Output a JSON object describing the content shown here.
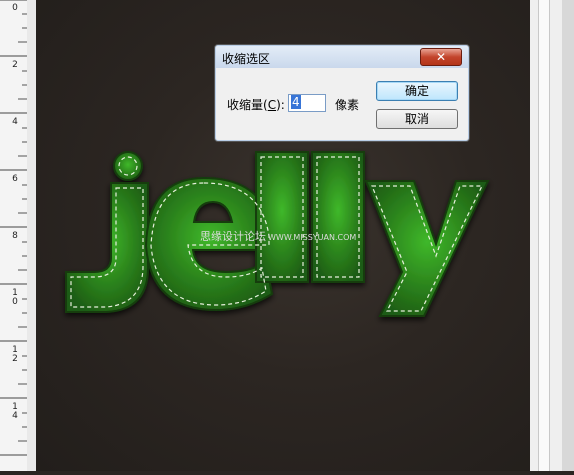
{
  "ruler": {
    "labels": [
      "0",
      "2",
      "4",
      "6",
      "8",
      "10",
      "12",
      "14"
    ]
  },
  "artwork": {
    "text": "jelly",
    "fill_color": "#2e8b1e",
    "stitch_color": "#e6f0dc"
  },
  "watermark": {
    "cn": "思缘设计论坛",
    "en": "WWW.MISSYUAN.COM"
  },
  "dialog": {
    "title": "收缩选区",
    "close": "✕",
    "field_label_prefix": "收缩量(",
    "field_label_key": "C",
    "field_label_suffix": "):",
    "value": "4",
    "unit": "像素",
    "ok_label": "确定",
    "cancel_label": "取消"
  }
}
